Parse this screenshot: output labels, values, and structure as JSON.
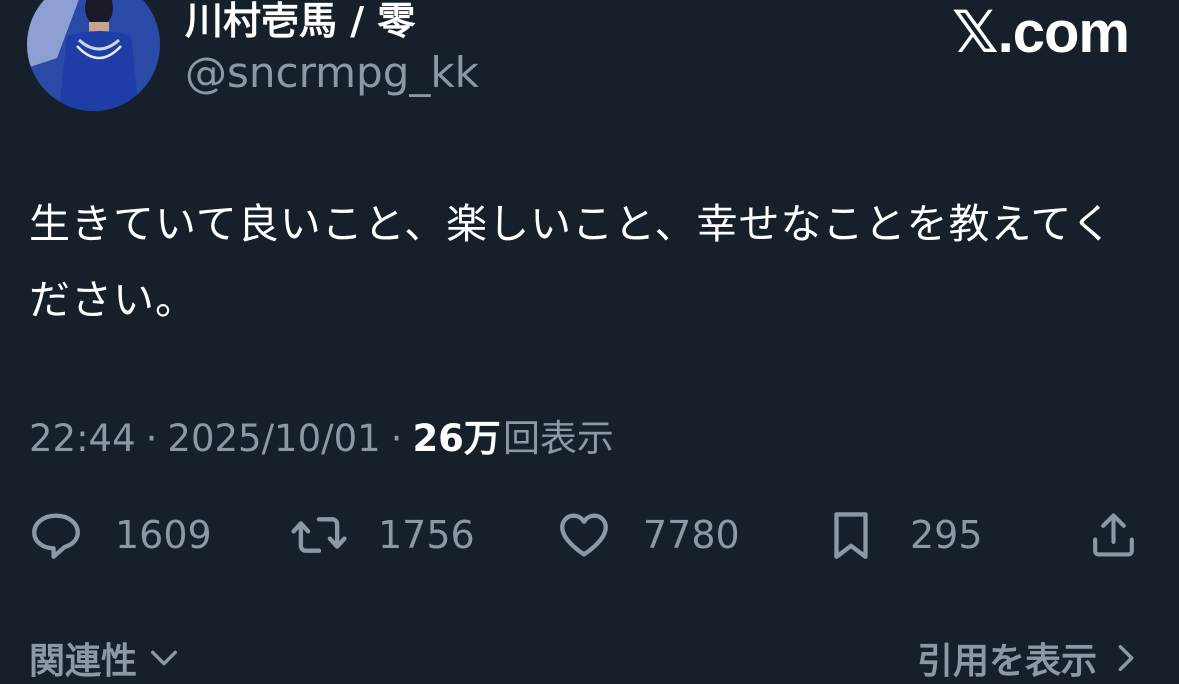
{
  "author": {
    "display_name": "川村壱馬 / 零",
    "handle": "@sncrmpg_kk",
    "avatar_icon": "profile-photo"
  },
  "brand": "𝕏.com",
  "tweet": {
    "text": "生きていて良いこと、楽しいこと、幸せなことを教えてください。"
  },
  "meta": {
    "time": "22:44",
    "separator": "·",
    "date": "2025/10/01",
    "views_count": "26万",
    "views_label": "回表示"
  },
  "actions": {
    "replies": "1609",
    "retweets": "1756",
    "likes": "7780",
    "bookmarks": "295"
  },
  "footer": {
    "related_label": "関連性",
    "quotes_label": "引用を表示"
  },
  "colors": {
    "background": "#15202b",
    "primary_text": "#ffffff",
    "secondary_text": "#8b98a5"
  }
}
